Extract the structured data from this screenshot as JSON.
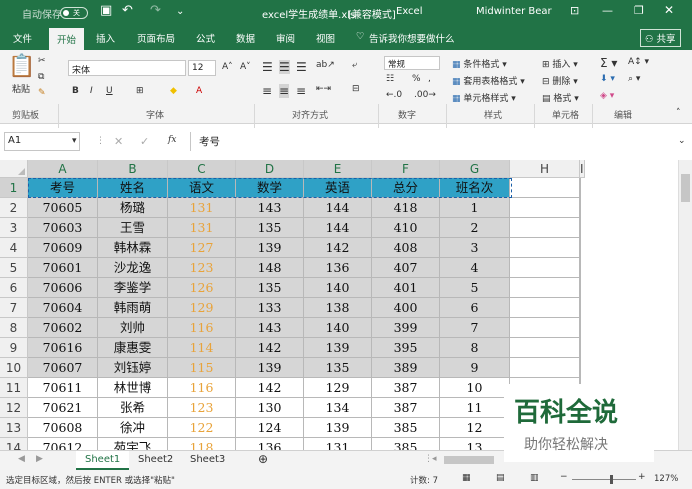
{
  "title": {
    "autosave": "自动保存",
    "switch": "关",
    "doc": "excel学生成绩单.xls",
    "mode": "[兼容模式]",
    "app": "Excel",
    "user": "Midwinter Bear"
  },
  "ribbon_tabs": [
    "文件",
    "开始",
    "插入",
    "页面布局",
    "公式",
    "数据",
    "审阅",
    "视图"
  ],
  "tell_me": "告诉我你想要做什么",
  "share": "共享",
  "ribbon": {
    "paste": "粘贴",
    "clipboard": "剪贴板",
    "font_name": "宋体",
    "font_size": "12",
    "font_group": "字体",
    "align_group": "对齐方式",
    "num_format": "常规",
    "number_group": "数字",
    "cond_format": "条件格式",
    "table_format": "套用表格格式",
    "cell_style": "单元格样式",
    "style_group": "样式",
    "insert": "插入",
    "delete": "删除",
    "format": "格式",
    "cells_group": "单元格",
    "edit_group": "编辑"
  },
  "formula": {
    "namebox": "A1",
    "fx": "fx",
    "content": "考号"
  },
  "columns": [
    "A",
    "B",
    "C",
    "D",
    "E",
    "F",
    "G",
    "H",
    "I"
  ],
  "header_row": [
    "考号",
    "姓名",
    "语文",
    "数学",
    "英语",
    "总分",
    "班名次"
  ],
  "rows": [
    [
      "70605",
      "杨璐",
      "131",
      "143",
      "144",
      "418",
      "1"
    ],
    [
      "70603",
      "王雪",
      "131",
      "135",
      "144",
      "410",
      "2"
    ],
    [
      "70609",
      "韩林霖",
      "127",
      "139",
      "142",
      "408",
      "3"
    ],
    [
      "70601",
      "沙龙逸",
      "123",
      "148",
      "136",
      "407",
      "4"
    ],
    [
      "70606",
      "李鉴学",
      "126",
      "135",
      "140",
      "401",
      "5"
    ],
    [
      "70604",
      "韩雨萌",
      "129",
      "133",
      "138",
      "400",
      "6"
    ],
    [
      "70602",
      "刘帅",
      "116",
      "143",
      "140",
      "399",
      "7"
    ],
    [
      "70616",
      "康惠雯",
      "114",
      "142",
      "139",
      "395",
      "8"
    ],
    [
      "70607",
      "刘钰婷",
      "115",
      "139",
      "135",
      "389",
      "9"
    ],
    [
      "70611",
      "林世博",
      "116",
      "142",
      "129",
      "387",
      "10"
    ],
    [
      "70621",
      "张希",
      "123",
      "130",
      "134",
      "387",
      "11"
    ],
    [
      "70608",
      "徐冲",
      "122",
      "124",
      "139",
      "385",
      "12"
    ],
    [
      "70612",
      "苑宇飞",
      "118",
      "136",
      "131",
      "385",
      "13"
    ]
  ],
  "row_numbers": [
    "1",
    "2",
    "3",
    "4",
    "5",
    "6",
    "7",
    "8",
    "9",
    "10",
    "11",
    "12",
    "13",
    "14"
  ],
  "sheets": [
    "Sheet1",
    "Sheet2",
    "Sheet3"
  ],
  "status": {
    "message": "选定目标区域，然后按 ENTER 或选择\"粘贴\"",
    "count": "计数: 7",
    "zoom": "127%"
  },
  "watermark": {
    "brand": "百科全说",
    "slogan": "助你轻松解决"
  },
  "colors": {
    "excel_green": "#217346",
    "header_fill": "#2fa1c6",
    "data_fill": "#d6d6d6",
    "chinese_score": "#e8a33b",
    "tab_active": "#217346"
  }
}
